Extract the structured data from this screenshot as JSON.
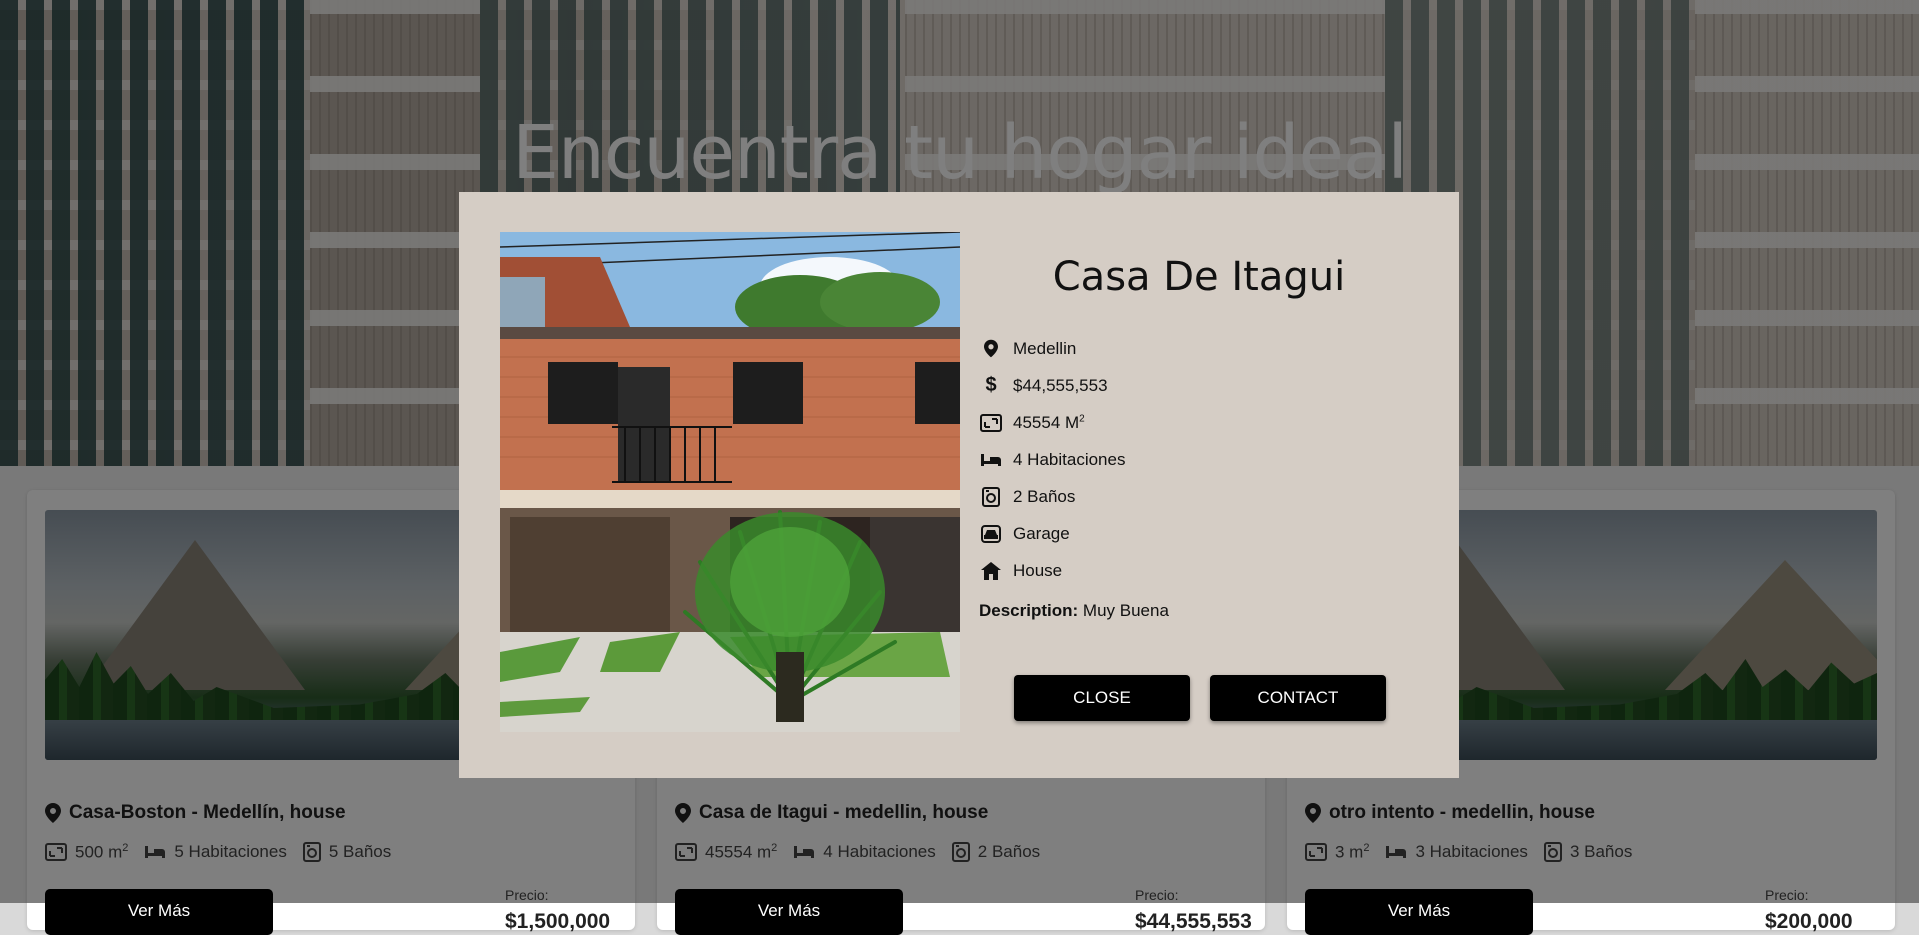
{
  "hero": {
    "title": "Encuentra tu hogar ideal"
  },
  "cards": [
    {
      "title": "Casa-Boston - Medellín, house",
      "area": "500 m",
      "area_sup": "2",
      "rooms": "5 Habitaciones",
      "baths": "5 Baños",
      "button": "Ver Más",
      "price_label": "Precio:",
      "price": "$1,500,000"
    },
    {
      "title": "Casa de Itagui - medellin, house",
      "area": "45554 m",
      "area_sup": "2",
      "rooms": "4 Habitaciones",
      "baths": "2 Baños",
      "button": "Ver Más",
      "price_label": "Precio:",
      "price": "$44,555,553"
    },
    {
      "title": "otro intento - medellin, house",
      "area": "3 m",
      "area_sup": "2",
      "rooms": "3 Habitaciones",
      "baths": "3 Baños",
      "button": "Ver Más",
      "price_label": "Precio:",
      "price": "$200,000"
    }
  ],
  "modal": {
    "title": "Casa De Itagui",
    "location": "Medellin",
    "price": "$44,555,553",
    "area": "45554 M",
    "area_sup": "2",
    "rooms": "4 Habitaciones",
    "baths": "2 Baños",
    "garage": "Garage",
    "type": "House",
    "description_label": "Description:",
    "description": "Muy Buena",
    "close_button": "CLOSE",
    "contact_button": "CONTACT"
  },
  "colors": {
    "modal_bg": "#d5cdc5",
    "button_bg": "#000000",
    "overlay": "rgba(0,0,0,0.5)"
  },
  "icons": [
    "map-pin-icon",
    "dollar-icon",
    "area-icon",
    "bed-icon",
    "bath-icon",
    "garage-icon",
    "house-icon"
  ]
}
